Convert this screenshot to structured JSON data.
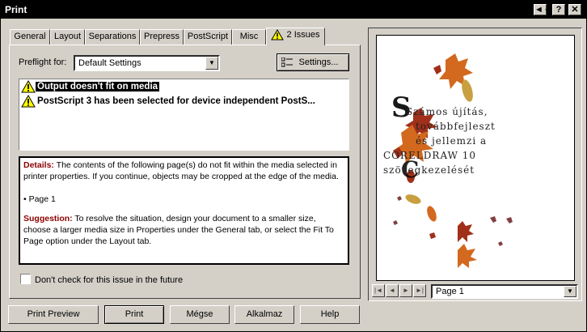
{
  "window": {
    "title": "Print",
    "buttons": {
      "restore": "◄◄",
      "help": "?",
      "close": "✕"
    }
  },
  "tabs": [
    {
      "label": "General"
    },
    {
      "label": "Layout"
    },
    {
      "label": "Separations"
    },
    {
      "label": "Prepress"
    },
    {
      "label": "PostScript"
    },
    {
      "label": "Misc"
    },
    {
      "label": "2 Issues",
      "icon": "warning-icon",
      "active": true
    }
  ],
  "preflight": {
    "label": "Preflight for:",
    "selected": "Default Settings",
    "settings_button": "Settings..."
  },
  "issues": [
    {
      "text": "Output doesn't fit on media",
      "icon": "warning-icon",
      "selected": true
    },
    {
      "text": "PostScript 3 has been selected for device independent PostS...",
      "icon": "warning-icon",
      "selected": false
    }
  ],
  "details": {
    "details_label": "Details:",
    "details_text": "The contents of the following page(s) do not fit within the media selected in printer properties. If you continue, objects may be cropped at the edge of the media.",
    "bullet": "Page 1",
    "suggestion_label": "Suggestion:",
    "suggestion_text": "To resolve the situation, design your document to a smaller size, choose a larger media size in Properties under the General tab, or select the Fit To Page option under the Layout tab."
  },
  "dont_check_label": "Don't check for this issue in the future",
  "bottom_buttons": {
    "print_preview": "Print Preview",
    "print": "Print",
    "cancel": "Mégse",
    "apply": "Alkalmaz",
    "help": "Help"
  },
  "preview": {
    "page_lines": [
      "Számos újítás,",
      "továbbfejleszt",
      "és jellemzi a",
      "CORELDRAW 10",
      "szövegkezelését"
    ],
    "page_selector": "Page 1",
    "colors": {
      "leaf_orange": "#d2691e",
      "leaf_red": "#a0301a",
      "leaf_yellow": "#c8a040"
    }
  }
}
